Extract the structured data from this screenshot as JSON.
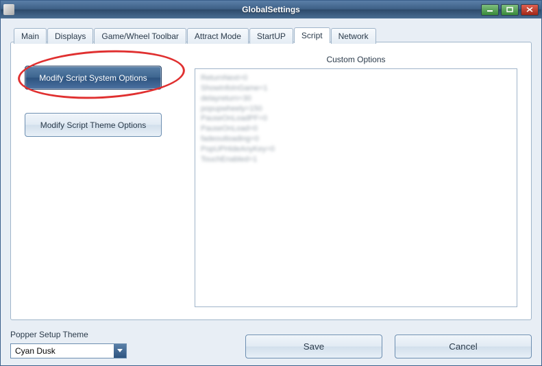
{
  "window": {
    "title": "GlobalSettings"
  },
  "tabs": [
    {
      "label": "Main"
    },
    {
      "label": "Displays"
    },
    {
      "label": "Game/Wheel Toolbar"
    },
    {
      "label": "Attract Mode"
    },
    {
      "label": "StartUP"
    },
    {
      "label": "Script",
      "active": true
    },
    {
      "label": "Network"
    }
  ],
  "script_tab": {
    "modify_system_label": "Modify Script System Options",
    "modify_theme_label": "Modify Script Theme Options",
    "custom_options_label": "Custom Options",
    "custom_options_lines": [
      "ReturnNext=0",
      "ShowInfoInGame=1",
      "delayreturn=30",
      "popupwheely=150",
      "PauseOnLoadPF=0",
      "PauseOnLoad=0",
      "fadeoutloading=0",
      "PopUPHideAnyKey=0",
      "TouchEnabled=1"
    ]
  },
  "footer": {
    "theme_label": "Popper Setup Theme",
    "theme_value": "Cyan Dusk",
    "save_label": "Save",
    "cancel_label": "Cancel"
  }
}
